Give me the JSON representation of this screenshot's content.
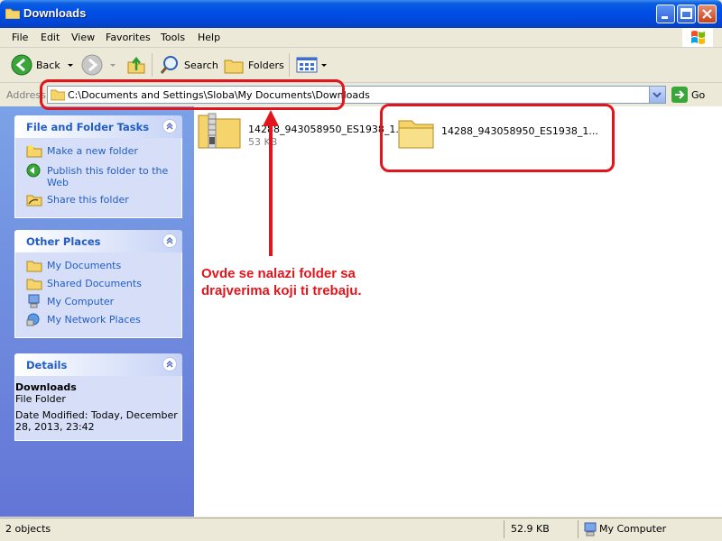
{
  "window": {
    "title": "Downloads"
  },
  "menu": [
    "File",
    "Edit",
    "View",
    "Favorites",
    "Tools",
    "Help"
  ],
  "toolbar": {
    "back": "Back",
    "search": "Search",
    "folders": "Folders"
  },
  "address": {
    "label": "Address",
    "path": "C:\\Documents and Settings\\Sloba\\My Documents\\Downloads",
    "go": "Go"
  },
  "tasks": {
    "title": "File and Folder Tasks",
    "items": [
      "Make a new folder",
      "Publish this folder to the Web",
      "Share this folder"
    ]
  },
  "places": {
    "title": "Other Places",
    "items": [
      "My Documents",
      "Shared Documents",
      "My Computer",
      "My Network Places"
    ]
  },
  "details": {
    "title": "Details",
    "name": "Downloads",
    "type": "File Folder",
    "modified": "Date Modified: Today, December 28, 2013, 23:42"
  },
  "files": [
    {
      "name": "14288_943058950_ES1938_1...",
      "size": "53 KB",
      "icon": "zip-folder-icon"
    },
    {
      "name": "14288_943058950_ES1938_1...",
      "icon": "folder-icon"
    }
  ],
  "annotation": {
    "text": "Ovde se nalazi folder sa drajverima koji ti trebaju.",
    "color": "#e2151c"
  },
  "status": {
    "objects": "2 objects",
    "size": "52.9 KB",
    "location": "My Computer"
  }
}
